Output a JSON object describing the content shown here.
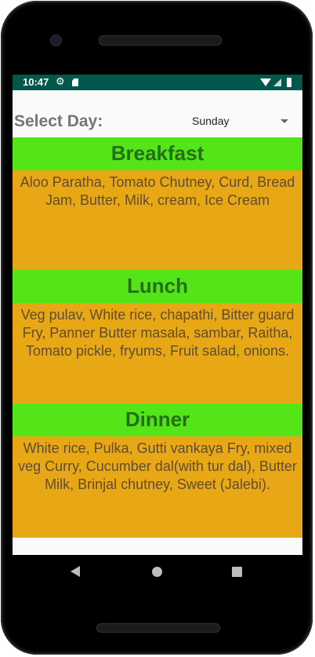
{
  "status_bar": {
    "time": "10:47",
    "icons": [
      "gear-icon",
      "sdcard-icon",
      "wifi-icon",
      "signal-icon",
      "battery-icon"
    ],
    "color": "#00574b"
  },
  "selector": {
    "label": "Select Day:",
    "selected_day": "Sunday"
  },
  "meals": [
    {
      "title": "Breakfast",
      "items": "Aloo Paratha, Tomato Chutney, Curd, Bread Jam, Butter, Milk, cream, Ice Cream"
    },
    {
      "title": "Lunch",
      "items": "Veg pulav, White rice, chapathi, Bitter guard Fry, Panner Butter masala, sambar, Raitha, Tomato pickle, fryums, Fruit salad, onions."
    },
    {
      "title": "Dinner",
      "items": "White rice, Pulka, Gutti vankaya Fry, mixed veg Curry, Cucumber dal(with tur dal), Butter Milk, Brinjal chutney, Sweet (Jalebi)."
    }
  ],
  "colors": {
    "header_bg": "#53e518",
    "header_text": "#247016",
    "body_bg": "#e8a715",
    "body_text": "#614c2c"
  },
  "nav_bar": {
    "icons": [
      "back-icon",
      "home-icon",
      "recents-icon"
    ]
  }
}
